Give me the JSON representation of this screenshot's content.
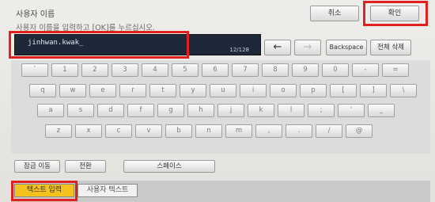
{
  "header": {
    "title": "사용자 이름",
    "instruction": "사용자 이름을 입력하고 [OK]를 누르십시오.",
    "cancel_label": "취소",
    "ok_label": "확인"
  },
  "input": {
    "value": "jinhwan.kwak_",
    "counter": "12/128"
  },
  "nav": {
    "left_arrow": "←",
    "right_arrow": "→",
    "backspace_label": "Backspace",
    "delete_all_label": "전체 삭제"
  },
  "keyboard": {
    "row1": [
      "`",
      "1",
      "2",
      "3",
      "4",
      "5",
      "6",
      "7",
      "8",
      "9",
      "0",
      "-",
      "="
    ],
    "row2": [
      "q",
      "w",
      "e",
      "r",
      "t",
      "y",
      "u",
      "i",
      "o",
      "p",
      "[",
      "]",
      "\\"
    ],
    "row3": [
      "a",
      "s",
      "d",
      "f",
      "g",
      "h",
      "j",
      "k",
      "l",
      ";",
      "'",
      "_"
    ],
    "row4": [
      "z",
      "x",
      "c",
      "v",
      "b",
      "n",
      "m",
      ",",
      ".",
      "/",
      "@"
    ]
  },
  "bottom": {
    "lock_label": "잠금 이동",
    "switch_label": "전환",
    "space_label": "스페이스"
  },
  "tabs": [
    {
      "label": "텍스트 입력",
      "active": true
    },
    {
      "label": "사용자 텍스트",
      "active": false
    }
  ]
}
